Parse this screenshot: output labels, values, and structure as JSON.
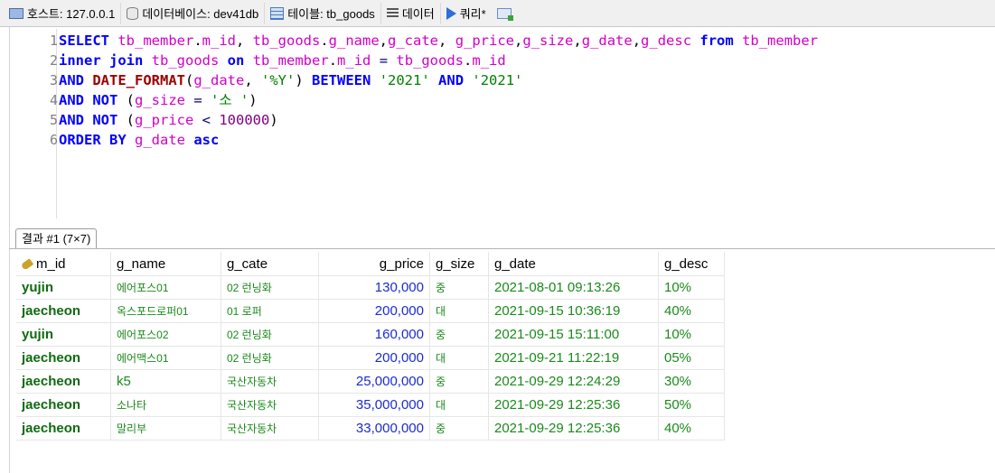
{
  "tabs": [
    {
      "label": "호스트: 127.0.0.1",
      "icon": "host-icon"
    },
    {
      "label": "데이터베이스: dev41db",
      "icon": "database-icon"
    },
    {
      "label": "테이블: tb_goods",
      "icon": "table-icon"
    },
    {
      "label": "데이터",
      "icon": "data-grid-icon"
    },
    {
      "label": "쿼리*",
      "icon": "query-play-icon"
    }
  ],
  "editor": {
    "lines": [
      {
        "num": "1",
        "tokens": [
          {
            "t": "SELECT ",
            "c": "kw"
          },
          {
            "t": "tb_member",
            "c": "id"
          },
          {
            "t": ".",
            "c": "sf"
          },
          {
            "t": "m_id",
            "c": "id"
          },
          {
            "t": ", ",
            "c": "sf"
          },
          {
            "t": "tb_goods",
            "c": "id"
          },
          {
            "t": ".",
            "c": "sf"
          },
          {
            "t": "g_name",
            "c": "id"
          },
          {
            "t": ",",
            "c": "sf"
          },
          {
            "t": "g_cate",
            "c": "id"
          },
          {
            "t": ", ",
            "c": "sf"
          },
          {
            "t": "g_price",
            "c": "id"
          },
          {
            "t": ",",
            "c": "sf"
          },
          {
            "t": "g_size",
            "c": "id"
          },
          {
            "t": ",",
            "c": "sf"
          },
          {
            "t": "g_date",
            "c": "id"
          },
          {
            "t": ",",
            "c": "sf"
          },
          {
            "t": "g_desc",
            "c": "id"
          },
          {
            "t": " ",
            "c": "sf"
          },
          {
            "t": "from",
            "c": "kw"
          },
          {
            "t": " ",
            "c": "sf"
          },
          {
            "t": "tb_member",
            "c": "id"
          }
        ]
      },
      {
        "num": "2",
        "tokens": [
          {
            "t": "inner join",
            "c": "kw"
          },
          {
            "t": " ",
            "c": "sf"
          },
          {
            "t": "tb_goods",
            "c": "id"
          },
          {
            "t": " ",
            "c": "sf"
          },
          {
            "t": "on",
            "c": "kw"
          },
          {
            "t": " ",
            "c": "sf"
          },
          {
            "t": "tb_member",
            "c": "id"
          },
          {
            "t": ".",
            "c": "sf"
          },
          {
            "t": "m_id",
            "c": "id"
          },
          {
            "t": " = ",
            "c": "op"
          },
          {
            "t": "tb_goods",
            "c": "id"
          },
          {
            "t": ".",
            "c": "sf"
          },
          {
            "t": "m_id",
            "c": "id"
          }
        ]
      },
      {
        "num": "3",
        "tokens": [
          {
            "t": "AND",
            "c": "kw"
          },
          {
            "t": " ",
            "c": "sf"
          },
          {
            "t": "DATE_FORMAT",
            "c": "fn"
          },
          {
            "t": "(",
            "c": "sf"
          },
          {
            "t": "g_date",
            "c": "id"
          },
          {
            "t": ", ",
            "c": "sf"
          },
          {
            "t": "'%Y'",
            "c": "str"
          },
          {
            "t": ") ",
            "c": "sf"
          },
          {
            "t": "BETWEEN",
            "c": "kw"
          },
          {
            "t": " ",
            "c": "sf"
          },
          {
            "t": "'2021'",
            "c": "str"
          },
          {
            "t": " ",
            "c": "sf"
          },
          {
            "t": "AND",
            "c": "kw"
          },
          {
            "t": " ",
            "c": "sf"
          },
          {
            "t": "'2021'",
            "c": "str"
          }
        ]
      },
      {
        "num": "4",
        "tokens": [
          {
            "t": "AND NOT",
            "c": "kw"
          },
          {
            "t": " (",
            "c": "sf"
          },
          {
            "t": "g_size",
            "c": "id"
          },
          {
            "t": " = ",
            "c": "op"
          },
          {
            "t": "'소 '",
            "c": "str"
          },
          {
            "t": ")",
            "c": "sf"
          }
        ]
      },
      {
        "num": "5",
        "tokens": [
          {
            "t": "AND NOT",
            "c": "kw"
          },
          {
            "t": " (",
            "c": "sf"
          },
          {
            "t": "g_price",
            "c": "id"
          },
          {
            "t": " < ",
            "c": "op"
          },
          {
            "t": "100000",
            "c": "num"
          },
          {
            "t": ")",
            "c": "sf"
          }
        ]
      },
      {
        "num": "6",
        "tokens": [
          {
            "t": "ORDER BY",
            "c": "kw"
          },
          {
            "t": " ",
            "c": "sf"
          },
          {
            "t": "g_date",
            "c": "id"
          },
          {
            "t": " ",
            "c": "sf"
          },
          {
            "t": "asc",
            "c": "kw"
          }
        ]
      }
    ]
  },
  "result": {
    "tab_label": "결과 #1 (7×7)",
    "columns": [
      "m_id",
      "g_name",
      "g_cate",
      "g_price",
      "g_size",
      "g_date",
      "g_desc"
    ],
    "rows": [
      [
        "yujin",
        "에어포스01",
        "02 런닝화",
        "130,000",
        "중",
        "2021-08-01 09:13:26",
        "10%"
      ],
      [
        "jaecheon",
        "옥스포드로퍼01",
        "01 로퍼",
        "200,000",
        "대",
        "2021-09-15 10:36:19",
        "40%"
      ],
      [
        "yujin",
        "에어포스02",
        "02 런닝화",
        "160,000",
        "중",
        "2021-09-15 15:11:00",
        "10%"
      ],
      [
        "jaecheon",
        "에어맥스01",
        "02 런닝화",
        "200,000",
        "대",
        "2021-09-21 11:22:19",
        "05%"
      ],
      [
        "jaecheon",
        "k5",
        "국산자동차",
        "25,000,000",
        "중",
        "2021-09-29 12:24:29",
        "30%"
      ],
      [
        "jaecheon",
        "소나타",
        "국산자동차",
        "35,000,000",
        "대",
        "2021-09-29 12:25:36",
        "50%"
      ],
      [
        "jaecheon",
        "말리부",
        "국산자동차",
        "33,000,000",
        "중",
        "2021-09-29 12:25:36",
        "40%"
      ]
    ]
  },
  "colors": {
    "keyword": "#0000ff",
    "identifier": "#d100c6",
    "string": "#008000",
    "number": "#800080",
    "function": "#9b0000"
  }
}
